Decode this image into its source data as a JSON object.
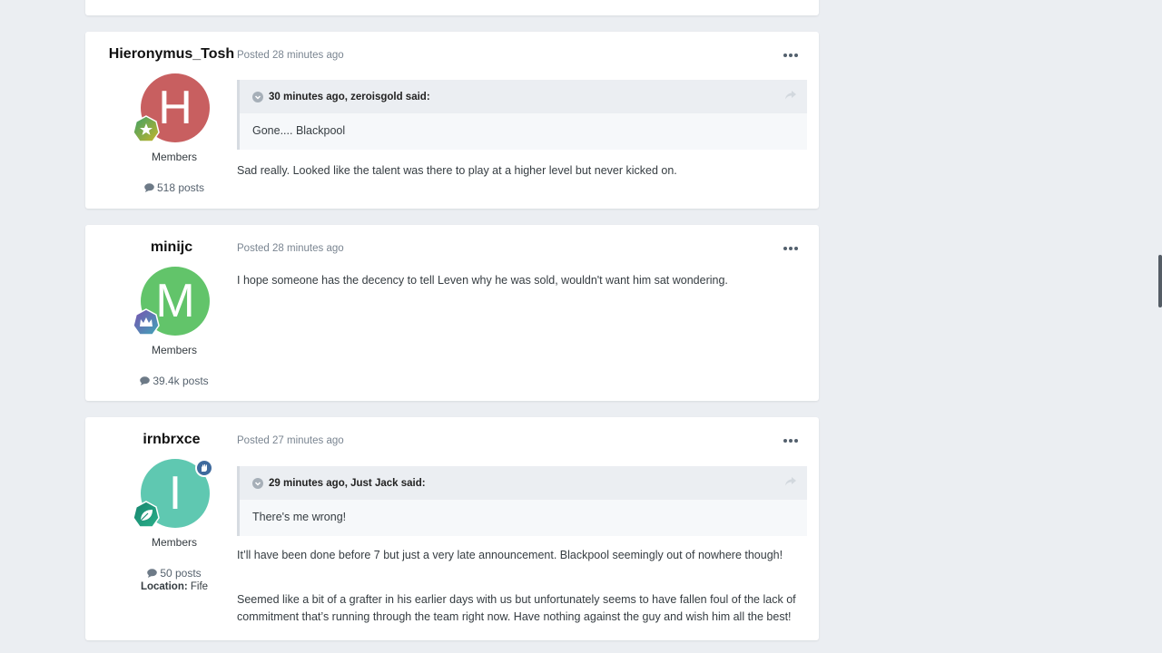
{
  "posts": [
    {
      "author": "Hieronymus_Tosh",
      "avatar_letter": "H",
      "avatar_color": "#c85f60",
      "rank_badge_color": "#6aa23a",
      "group": "Members",
      "post_count": "518 posts",
      "posted": "Posted 28 minutes ago",
      "quote": {
        "header": "30 minutes ago, zeroisgold said:",
        "body": "Gone.... Blackpool"
      },
      "paragraphs": [
        "Sad really. Looked like the talent was there to play at a higher level but never kicked on."
      ]
    },
    {
      "author": "minijc",
      "avatar_letter": "M",
      "avatar_color": "#62c46a",
      "rank_badge_color": "#6b5fa8",
      "group": "Members",
      "post_count": "39.4k posts",
      "posted": "Posted 28 minutes ago",
      "paragraphs": [
        "I hope someone has the decency to tell Leven why he was sold, wouldn't want him sat wondering."
      ]
    },
    {
      "author": "irnbrxce",
      "avatar_letter": "I",
      "avatar_color": "#5fc8b1",
      "rank_badge_color": "#1f8f77",
      "group": "Members",
      "post_count": "50 posts",
      "location_label": "Location:",
      "location_value": "Fife",
      "posted": "Posted 27 minutes ago",
      "quote": {
        "header": "29 minutes ago, Just Jack said:",
        "body": "There's me wrong!"
      },
      "paragraphs": [
        "It’ll have been done before 7 but just a very late announcement. Blackpool seemingly out of nowhere though!",
        "Seemed like a bit of a grafter in his earlier days with us but unfortunately seems to have fallen foul of the lack of commitment that’s running through the team right now. Have nothing against the guy and wish him all the best!"
      ]
    }
  ]
}
